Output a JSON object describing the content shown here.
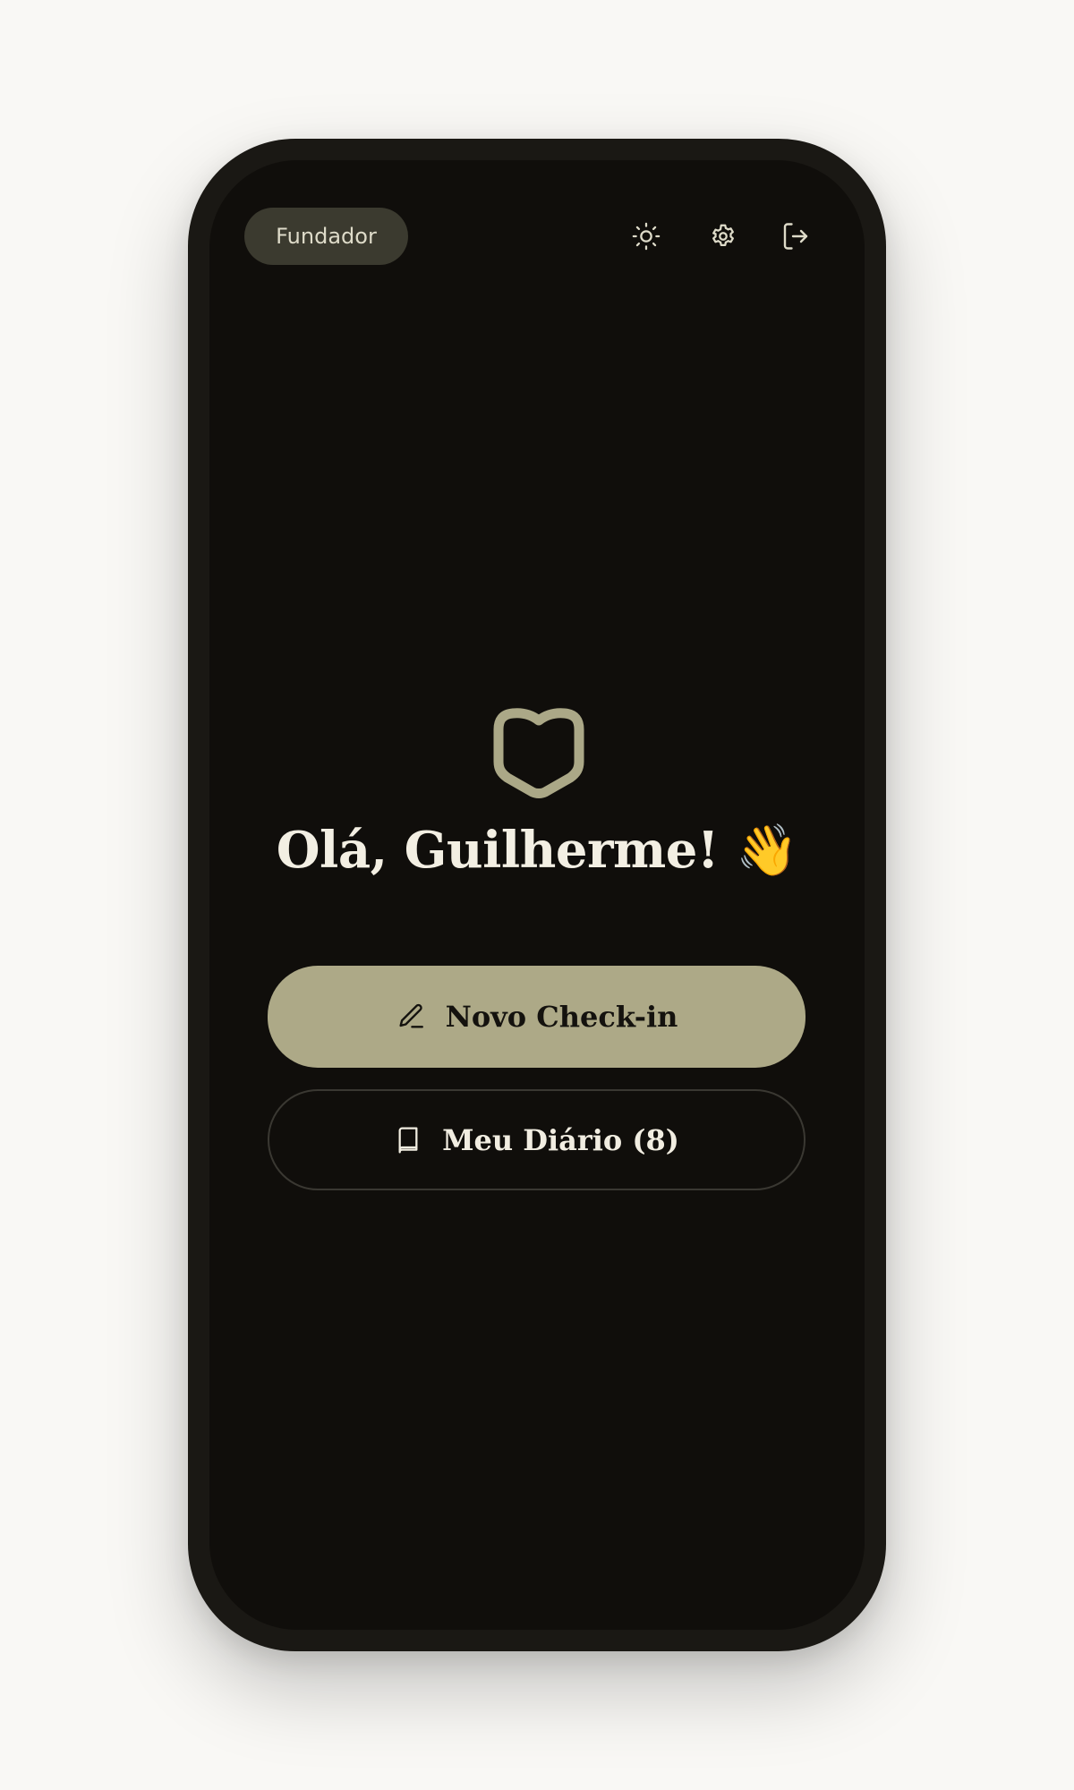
{
  "header": {
    "badge_label": "Fundador",
    "icons": [
      "sun-icon",
      "gear-icon",
      "logout-icon"
    ]
  },
  "main": {
    "logo_icon": "heart-shield-icon",
    "greeting": "Olá, Guilherme!",
    "greeting_emoji": "👋",
    "primary_button": "Novo Check-in",
    "secondary_button": "Meu Diário (8)"
  },
  "colors": {
    "background": "#f9f8f5",
    "frame": "#1a1814",
    "screen": "#100e0b",
    "accent": "#ada987",
    "badge_bg": "#3b3a2f",
    "text_light": "#f3efe3"
  }
}
